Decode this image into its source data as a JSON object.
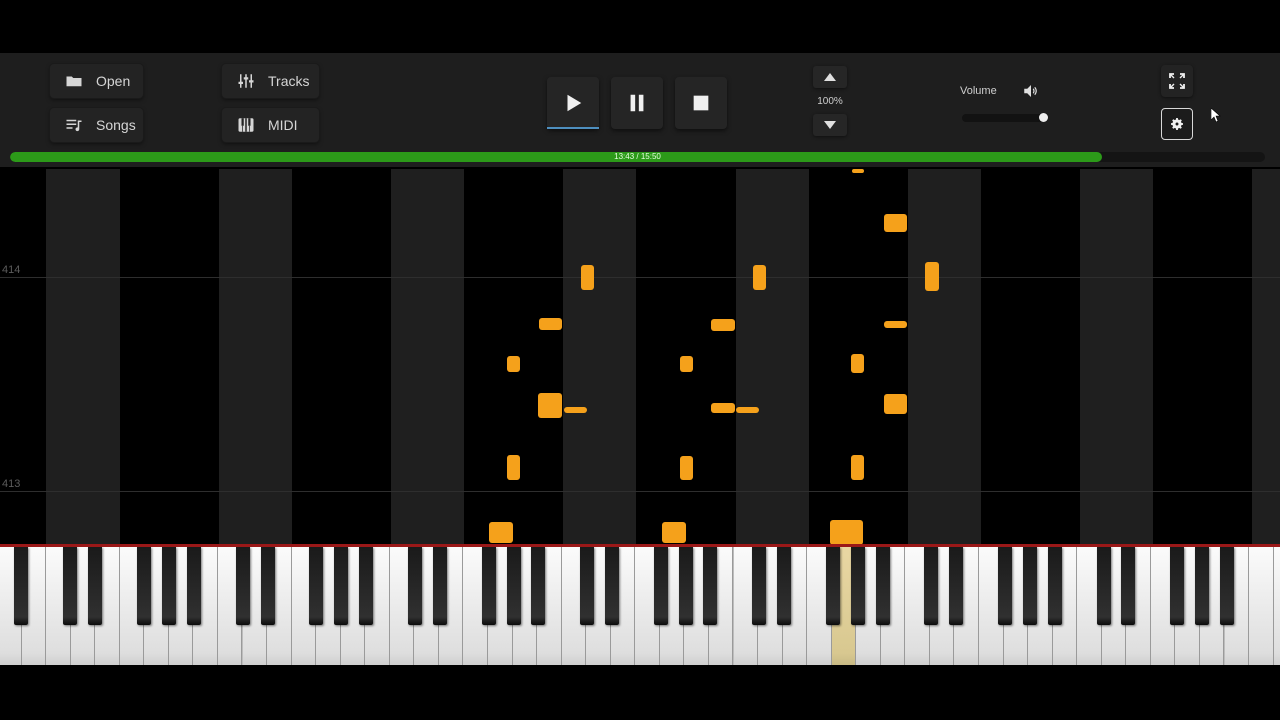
{
  "toolbar": {
    "open_label": "Open",
    "songs_label": "Songs",
    "tracks_label": "Tracks",
    "midi_label": "MIDI",
    "speed_value": "100%",
    "volume_label": "Volume",
    "volume_level": 0.97
  },
  "progress": {
    "text": "13:43 / 15:50",
    "fraction": 0.87
  },
  "roll": {
    "measure_labels": [
      "414",
      "413"
    ],
    "note_color": "#f5a11b",
    "lane_color": "#1f1f1f"
  },
  "keyboard": {
    "highlight_color": "#e2cf95",
    "active_key": "highlighted key under falling note"
  },
  "colors": {
    "progress_fill": "#2c9a19",
    "play_accent": "#4e8fbf",
    "keyboard_redline": "#9b1818"
  }
}
